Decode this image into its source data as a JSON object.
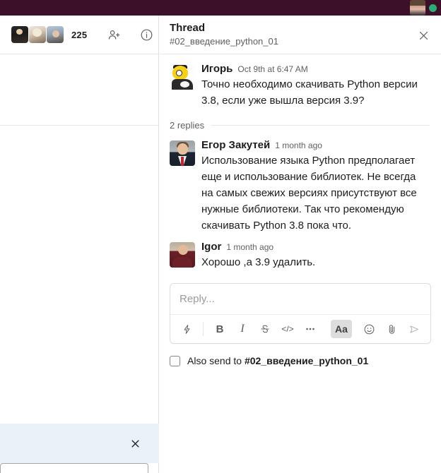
{
  "topbar": {
    "avatar_name": "user-avatar",
    "presence": "online",
    "presence_color": "#2bac76",
    "background_color": "#3D1029"
  },
  "channel_header": {
    "member_count": "225",
    "members_icon": "members-avatars",
    "add_person_icon": "add-person-icon",
    "info_icon": "info-icon"
  },
  "left_panel": {
    "close_icon": "close-icon",
    "background_color": "#e8f2f8"
  },
  "thread": {
    "title": "Thread",
    "channel": "#02_введение_python_01",
    "close_icon": "close-icon",
    "replies_label": "2 replies",
    "root_message": {
      "author": "Игорь",
      "timestamp": "Oct 9th at 6:47 AM",
      "text": "Точно необходимо скачивать Python версии 3.8, если уже вышла версия 3.9?"
    },
    "replies": [
      {
        "author": "Егор Закутей",
        "timestamp": "1 month ago",
        "text": "Использование языка Python предполагает еще и использование библиотек. Не всегда на самых свежих версиях присутствуют все нужные библиотеки. Так что рекомендую скачивать Python 3.8 пока что."
      },
      {
        "author": "Igor",
        "timestamp": "1 month ago",
        "text": "Хорошо ,а 3.9 удалить."
      }
    ]
  },
  "composer": {
    "placeholder": "Reply...",
    "value": "",
    "toolbar": {
      "shortcuts_label": "",
      "bold_label": "B",
      "italic_label": "I",
      "strikethrough_label": "",
      "code_label": "</>",
      "more_label": "",
      "formatting_label": "Aa",
      "emoji_label": "",
      "attach_label": "",
      "send_label": ""
    }
  },
  "also_send": {
    "prefix": "Also send to",
    "channel": "#02_введение_python_01",
    "checked": false
  }
}
